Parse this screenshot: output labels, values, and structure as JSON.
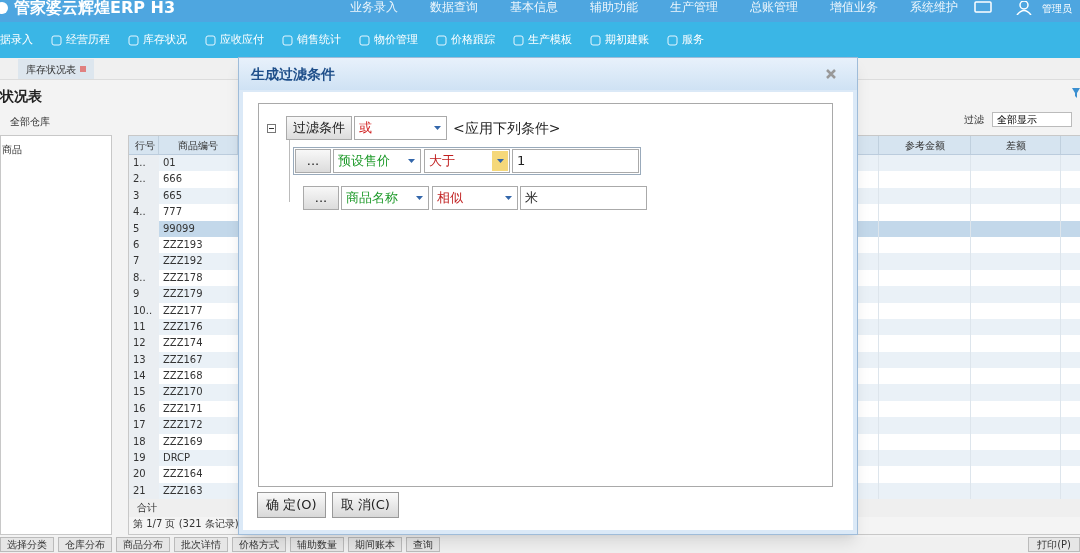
{
  "app": {
    "logo": "管家婆云辉煌ERP H3",
    "menu": [
      "业务录入",
      "数据查询",
      "基本信息",
      "辅助功能",
      "生产管理",
      "总账管理",
      "增值业务",
      "系统维护"
    ],
    "user": "管理员"
  },
  "toolbar": [
    "据录入",
    "经营历程",
    "库存状况",
    "应收应付",
    "销售统计",
    "物价管理",
    "价格跟踪",
    "生产模板",
    "期初建账",
    "服务"
  ],
  "tabs": [
    {
      "label": "库存状况表",
      "selected": true
    }
  ],
  "report": {
    "title": "状况表",
    "warehouse": "全部仓库",
    "tree_header": "商品",
    "filter_label": "过滤",
    "filter_value": "全部显示",
    "columns": [
      "行号",
      "商品编号",
      "参考金额",
      "差额"
    ],
    "rows": [
      {
        "no": "1..",
        "code": "01",
        "selected": false
      },
      {
        "no": "2..",
        "code": "666",
        "selected": false
      },
      {
        "no": "3",
        "code": "665",
        "selected": false
      },
      {
        "no": "4..",
        "code": "777",
        "selected": false
      },
      {
        "no": "5",
        "code": "99099",
        "selected": true
      },
      {
        "no": "6",
        "code": "ZZZ193",
        "selected": false
      },
      {
        "no": "7",
        "code": "ZZZ192",
        "selected": false
      },
      {
        "no": "8..",
        "code": "ZZZ178",
        "selected": false
      },
      {
        "no": "9",
        "code": "ZZZ179",
        "selected": false
      },
      {
        "no": "10..",
        "code": "ZZZ177",
        "selected": false
      },
      {
        "no": "11",
        "code": "ZZZ176",
        "selected": false
      },
      {
        "no": "12",
        "code": "ZZZ174",
        "selected": false
      },
      {
        "no": "13",
        "code": "ZZZ167",
        "selected": false
      },
      {
        "no": "14",
        "code": "ZZZ168",
        "selected": false
      },
      {
        "no": "15",
        "code": "ZZZ170",
        "selected": false
      },
      {
        "no": "16",
        "code": "ZZZ171",
        "selected": false
      },
      {
        "no": "17",
        "code": "ZZZ172",
        "selected": false
      },
      {
        "no": "18",
        "code": "ZZZ169",
        "selected": false
      },
      {
        "no": "19",
        "code": "DRCP",
        "selected": false
      },
      {
        "no": "20",
        "code": "ZZZ164",
        "selected": false
      },
      {
        "no": "21",
        "code": "ZZZ163",
        "selected": false
      }
    ],
    "total_label": "合计",
    "pager": "第 1/7 页 (321 条记录)"
  },
  "bottom_buttons": [
    "选择分类",
    "仓库分布",
    "商品分布",
    "批次详情",
    "价格方式",
    "辅助数量",
    "期间账本",
    "查询"
  ],
  "print_button": "打印(P)",
  "dialog": {
    "title": "生成过滤条件",
    "root": {
      "label": "过滤条件",
      "logic": "或",
      "hint": "<应用下列条件>",
      "expanded": true
    },
    "conditions": [
      {
        "more": "...",
        "field": "预设售价",
        "operator": "大于",
        "value": "1",
        "focused": true
      },
      {
        "more": "...",
        "field": "商品名称",
        "operator": "相似",
        "value": "米",
        "focused": false
      }
    ],
    "buttons": [
      "确 定(O)",
      "取 消(C)"
    ]
  }
}
